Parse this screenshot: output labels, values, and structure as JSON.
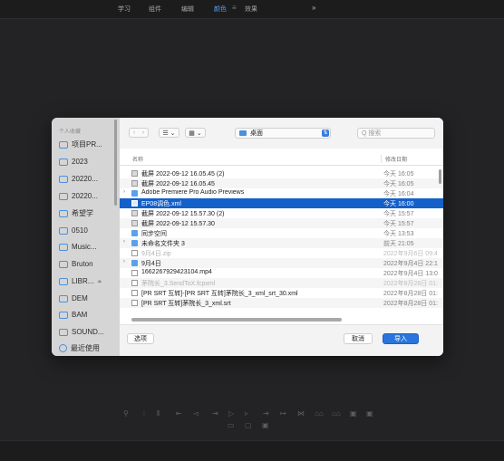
{
  "topbar": {
    "tabs": [
      {
        "label": "学习",
        "active": false
      },
      {
        "label": "组件",
        "active": false
      },
      {
        "label": "编辑",
        "active": false
      },
      {
        "label": "颜色",
        "active": true
      },
      {
        "label": "效果",
        "active": false
      }
    ],
    "separator": "≡",
    "more": "»"
  },
  "dialog": {
    "sidebar": {
      "section_label": "个人收藏",
      "items": [
        {
          "label": "项目PR...",
          "icon": "folder-icon"
        },
        {
          "label": "2023",
          "icon": "folder-icon"
        },
        {
          "label": "20220...",
          "icon": "folder-icon"
        },
        {
          "label": "20220...",
          "icon": "folder-icon"
        },
        {
          "label": "希望学",
          "icon": "folder-icon"
        },
        {
          "label": "0510",
          "icon": "folder-icon"
        },
        {
          "label": "Music...",
          "icon": "folder-icon"
        },
        {
          "label": "Bruton",
          "icon": "folder-icon"
        },
        {
          "label": "LIBR...",
          "icon": "drive-icon",
          "eject": "⏏"
        },
        {
          "label": "DEM",
          "icon": "folder-icon"
        },
        {
          "label": "BAM",
          "icon": "folder-icon"
        },
        {
          "label": "SOUND...",
          "icon": "folder-icon"
        },
        {
          "label": "最近使用",
          "icon": "clock-icon"
        }
      ]
    },
    "toolbar": {
      "back": "‹",
      "forward": "›",
      "list_view": "☰ ⌄",
      "group_view": "▦ ⌄",
      "location": "桌面",
      "location_arrows": "⇅",
      "search_placeholder": "Q 搜索"
    },
    "columns": {
      "name": "名称",
      "date": "修改日期"
    },
    "files": [
      {
        "name": "截屏 2022-09-12 16.05.45 (2)",
        "date": "今天 16:05",
        "type": "img",
        "expand": "",
        "style": ""
      },
      {
        "name": "截屏 2022-09-12 16.05.45",
        "date": "今天 16:05",
        "type": "img",
        "expand": "",
        "style": "alt"
      },
      {
        "name": "Adobe Premiere Pro Audio Previews",
        "date": "今天 16:04",
        "type": "folder",
        "expand": "›",
        "style": ""
      },
      {
        "name": "EP08调色.xml",
        "date": "今天 16:00",
        "type": "file",
        "expand": "",
        "style": "sel"
      },
      {
        "name": "截屏 2022-09-12 15.57.30 (2)",
        "date": "今天 15:57",
        "type": "img",
        "expand": "",
        "style": ""
      },
      {
        "name": "截屏 2022-09-12 15.57.30",
        "date": "今天 15:57",
        "type": "img",
        "expand": "",
        "style": "alt"
      },
      {
        "name": "同步空间",
        "date": "今天 13:53",
        "type": "folder",
        "expand": "",
        "style": ""
      },
      {
        "name": "未命名文件夹 3",
        "date": "前天 21:05",
        "type": "folder",
        "expand": "›",
        "style": "alt"
      },
      {
        "name": "9月4日.zip",
        "date": "2022年9月6日 09:4",
        "type": "file",
        "expand": "",
        "style": "dim"
      },
      {
        "name": "9月4日",
        "date": "2022年9月4日 22:1",
        "type": "folder",
        "expand": "›",
        "style": "alt"
      },
      {
        "name": "1662267929423104.mp4",
        "date": "2022年9月4日 13:0",
        "type": "file",
        "expand": "",
        "style": ""
      },
      {
        "name": "茅院长_3.SendToX.fcpxml",
        "date": "2022年8月28日 01:",
        "type": "file",
        "expand": "",
        "style": "dim alt"
      },
      {
        "name": "[PR SRT 互转]-[PR SRT 互转]茅院长_3_xml_srt_30.xml",
        "date": "2022年8月28日 01:",
        "type": "file",
        "expand": "",
        "style": ""
      },
      {
        "name": "[PR SRT 互转]茅院长_3_xml.srt",
        "date": "2022年8月28日 01:",
        "type": "file",
        "expand": "",
        "style": "alt"
      }
    ],
    "footer": {
      "options": "选项",
      "cancel": "取消",
      "import": "导入"
    }
  },
  "transport": {
    "row1": [
      "⚲",
      "⋮",
      "⦀",
      "⇤",
      "◅",
      "⇥",
      "▷",
      "▹",
      "⇥",
      "↦",
      "⋈",
      "⌂⌂",
      "⌂⌂",
      "▣",
      "▣"
    ],
    "row2": [
      "▭",
      "▢",
      "▣"
    ]
  }
}
